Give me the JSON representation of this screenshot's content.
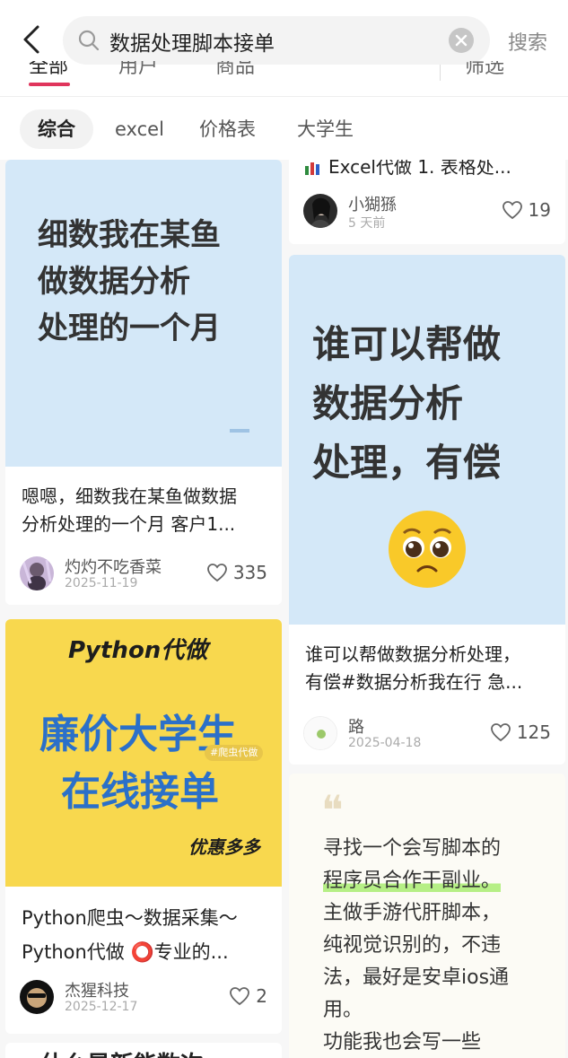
{
  "search": {
    "query": "数据处理脚本接单",
    "button_label": "搜索"
  },
  "tabs_partial": [
    "全部",
    "用户",
    "商品",
    "筛选"
  ],
  "chips": [
    "综合",
    "excel",
    "价格表",
    "大学生"
  ],
  "posts": [
    {
      "cover_lines": [
        "细数我在某鱼",
        "做数据分析",
        "处理的一个月"
      ],
      "title_lines": [
        "嗯嗯，细数我在某鱼做数据",
        "分析处理的一个月 客户1..."
      ],
      "author": "灼灼不吃香菜",
      "date": "2025-11-19",
      "likes": "335"
    },
    {
      "title_partial": "Excel代做 1. 表格处...",
      "author": "小猢猻",
      "date": "5 天前",
      "likes": "19"
    },
    {
      "cover_lines": [
        "谁可以帮做",
        "数据分析",
        "处理，有偿"
      ],
      "emoji": "🥺",
      "title_lines": [
        "谁可以帮做数据分析处理，",
        "有偿#数据分析我在行 急..."
      ],
      "author": "路",
      "date": "2025-04-18",
      "likes": "125"
    },
    {
      "cover_top": "Python代做",
      "cover_lines": [
        "廉价大学生",
        "在线接单"
      ],
      "cover_tag": "#爬虫代做",
      "cover_bottom": "优惠多多",
      "title_lines": [
        "Python爬虫～数据采集～",
        "Python代做 ⭕专业的..."
      ],
      "author": "杰猩科技",
      "date": "2025-12-17",
      "likes": "2"
    },
    {
      "quote_mark": "❝",
      "body_lines": [
        "寻找一个会写脚本的",
        "程序员合作干副业。",
        "主做手游代肝脚本，",
        "纯视觉识别的，不违",
        "法，最好是安卓ios通",
        "用。",
        "功能我也会写一些"
      ]
    },
    {
      "partial_title": "· 什么是新能数次"
    }
  ],
  "colors": {
    "accent": "#e0355c",
    "cover_blue": "#d4e8f8",
    "cover_yellow": "#f8d84e",
    "highlight_green": "#b6ef86"
  }
}
